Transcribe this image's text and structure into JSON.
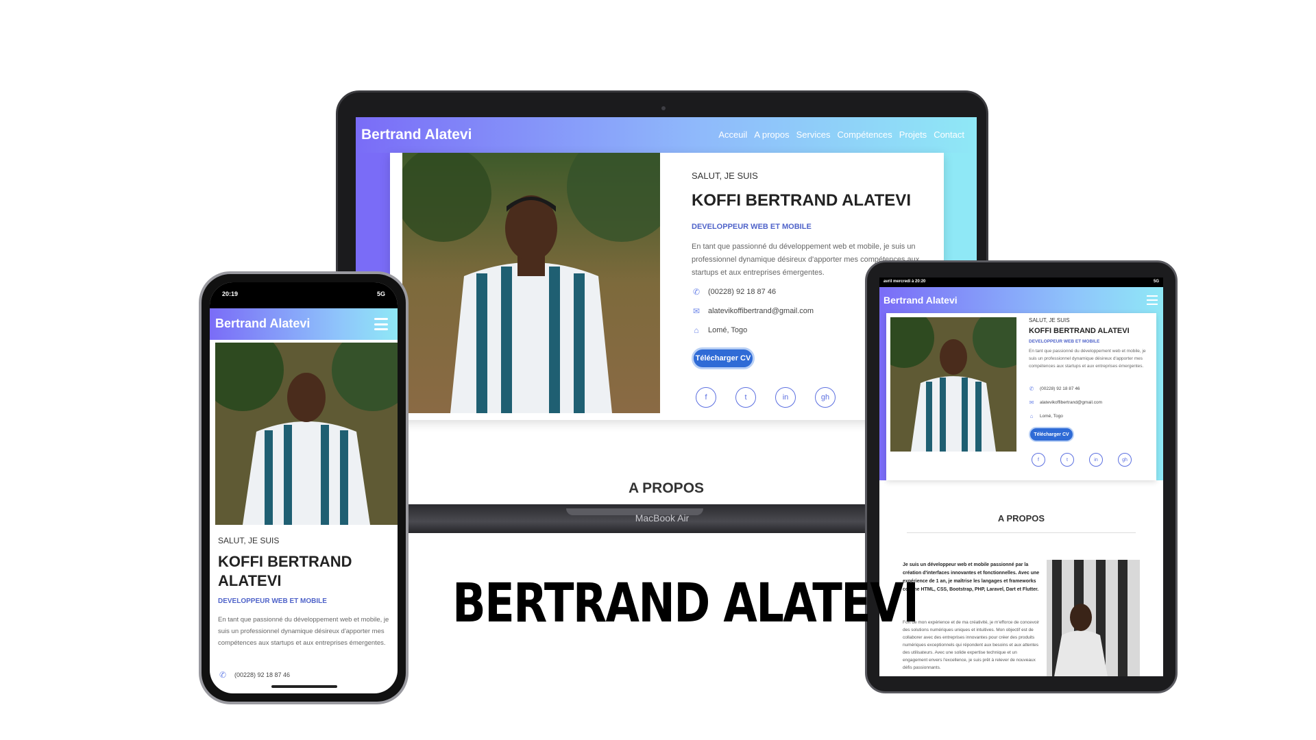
{
  "site": {
    "logo": "Bertrand Alatevi",
    "nav": [
      "Acceuil",
      "A propos",
      "Services",
      "Compétences",
      "Projets",
      "Contact"
    ],
    "hero": {
      "greeting": "SALUT, JE SUIS",
      "name": "KOFFI BERTRAND ALATEVI",
      "name_line1": "KOFFI BERTRAND",
      "name_line2": "ALATEVI",
      "role": "DEVELOPPEUR WEB ET MOBILE",
      "description": "En tant que passionné du développement web et mobile, je suis un professionnel dynamique désireux d'apporter mes compétences aux startups et aux entreprises émergentes.",
      "phone": "(00228) 92 18 87 46",
      "email": "alatevikoffibertrand@gmail.com",
      "location": "Lomé, Togo",
      "cv_button": "Télécharger CV",
      "socials": [
        "f",
        "t",
        "in",
        "gh"
      ]
    },
    "about": {
      "title": "A PROPOS",
      "intro": "Je suis un développeur web et mobile passionné par la création d'interfaces innovantes et fonctionnelles. Avec une expérience de 1 an, je maîtrise les langages et frameworks comme HTML, CSS, Bootstrap, PHP, Laravel, Dart et Flutter.",
      "body": "Fort de mon expérience et de ma créativité, je m'efforce de concevoir des solutions numériques uniques et intuitives. Mon objectif est de collaborer avec des entreprises innovantes pour créer des produits numériques exceptionnels qui répondent aux besoins et aux attentes des utilisateurs. Avec une solide expertise technique et un engagement envers l'excellence, je suis prêt à relever de nouveaux défis passionnants."
    }
  },
  "devices": {
    "laptop_brand": "MacBook Air",
    "phone_time": "20:19",
    "phone_signal": "5G",
    "tablet_date": "avril mercredi à 20:20",
    "tablet_signal": "5G"
  },
  "headline": "BERTRAND ALATEVI",
  "colors": {
    "gradient_start": "#7a6cf7",
    "gradient_end": "#8fe8f6",
    "accent_blue": "#2f6bd6",
    "role_blue": "#4f63c9"
  }
}
